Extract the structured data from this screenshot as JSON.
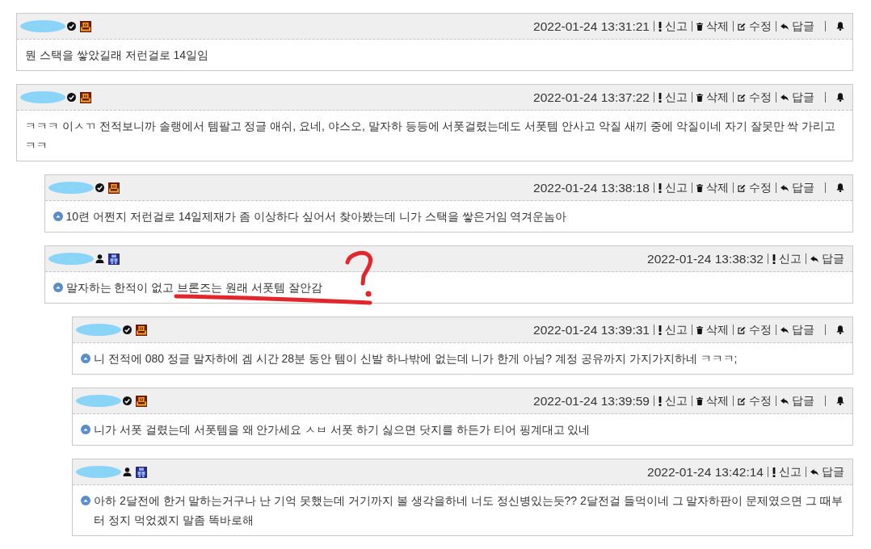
{
  "comments": [
    {
      "verified": true,
      "badge": {
        "kind": "crest"
      },
      "timestamp": "2022-01-24 13:31:21",
      "actions": [
        {
          "kind": "report",
          "label": "신고"
        },
        {
          "kind": "delete",
          "label": "삭제"
        },
        {
          "kind": "edit",
          "label": "수정"
        },
        {
          "kind": "reply",
          "label": "답글"
        },
        {
          "kind": "bell"
        }
      ],
      "text": "뭔 스택을 쌓았길래 저런걸로 14일임",
      "annotated": false
    },
    {
      "verified": true,
      "badge": {
        "kind": "crest"
      },
      "timestamp": "2022-01-24 13:37:22",
      "actions": [
        {
          "kind": "report",
          "label": "신고"
        },
        {
          "kind": "delete",
          "label": "삭제"
        },
        {
          "kind": "edit",
          "label": "수정"
        },
        {
          "kind": "reply",
          "label": "답글"
        },
        {
          "kind": "bell"
        }
      ],
      "text": "ㅋㅋㅋ 이ㅅㄲ 전적보니까 솔랭에서 템팔고 정글 애쉬, 요네, 야스오, 말자하 등등에 서폿걸렸는데도 서폿템 안사고 악질 새끼 중에 악질이네 자기 잘못만 싹 가리고 ㅋㅋ",
      "annotated": false,
      "children": [
        {
          "verified": true,
          "badge": {
            "kind": "crest"
          },
          "timestamp": "2022-01-24 13:38:18",
          "actions": [
            {
              "kind": "report",
              "label": "신고"
            },
            {
              "kind": "delete",
              "label": "삭제"
            },
            {
              "kind": "edit",
              "label": "수정"
            },
            {
              "kind": "reply",
              "label": "답글"
            },
            {
              "kind": "bell"
            }
          ],
          "text": "10련 어쩐지 저런걸로 14일제재가 좀 이상하다 싶어서 찾아봤는데 니가 스택을 쌓은거임 역겨운놈아",
          "annotated": false
        },
        {
          "verified": false,
          "badge": {
            "kind": "robot"
          },
          "timestamp": "2022-01-24 13:38:32",
          "actions": [
            {
              "kind": "report",
              "label": "신고"
            },
            {
              "kind": "reply",
              "label": "답글"
            }
          ],
          "text": "말자하는 한적이 없고 브론즈는 원래 서폿템 잘안감",
          "annotated": true,
          "children": [
            {
              "verified": true,
              "badge": {
                "kind": "crest"
              },
              "timestamp": "2022-01-24 13:39:31",
              "actions": [
                {
                  "kind": "report",
                  "label": "신고"
                },
                {
                  "kind": "delete",
                  "label": "삭제"
                },
                {
                  "kind": "edit",
                  "label": "수정"
                },
                {
                  "kind": "reply",
                  "label": "답글"
                },
                {
                  "kind": "bell"
                }
              ],
              "text": "니 전적에 080 정글 말자하에 겜 시간 28분 동안 템이 신발 하나밖에 없는데 니가 한게 아님? 계정 공유까지 가지가지하네 ㅋㅋㅋ;",
              "annotated": false
            },
            {
              "verified": true,
              "badge": {
                "kind": "crest"
              },
              "timestamp": "2022-01-24 13:39:59",
              "actions": [
                {
                  "kind": "report",
                  "label": "신고"
                },
                {
                  "kind": "delete",
                  "label": "삭제"
                },
                {
                  "kind": "edit",
                  "label": "수정"
                },
                {
                  "kind": "reply",
                  "label": "답글"
                },
                {
                  "kind": "bell"
                }
              ],
              "text": "니가 서폿 걸렸는데 서폿템을 왜 안가세요 ㅅㅂ 서폿 하기 싫으면 닷지를 하든가 티어 핑계대고 있네",
              "annotated": false
            },
            {
              "verified": false,
              "badge": {
                "kind": "robot"
              },
              "timestamp": "2022-01-24 13:42:14",
              "actions": [
                {
                  "kind": "report",
                  "label": "신고"
                },
                {
                  "kind": "reply",
                  "label": "답글"
                }
              ],
              "text": "아하 2달전에 한거 말하는거구나 난 기억 못했는데 거기까지 볼 생각을하네 너도 정신병있는듯?? 2달전걸 들먹이네 그 말자하판이 문제였으면 그 때부터 정지 먹었겠지 말좀 똑바로해",
              "annotated": false
            }
          ]
        }
      ]
    }
  ]
}
